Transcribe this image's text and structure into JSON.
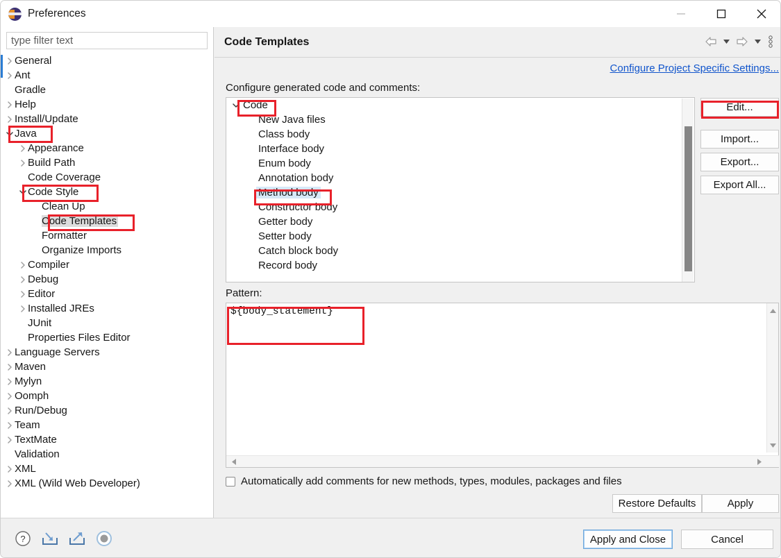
{
  "window": {
    "title": "Preferences",
    "app_icon": "eclipse-icon",
    "controls": {
      "minimize": "minimize-icon",
      "maximize": "maximize-icon",
      "close": "close-icon"
    }
  },
  "sidebar": {
    "filter": {
      "placeholder": "type filter text",
      "value": ""
    },
    "items": [
      {
        "label": "General",
        "indent": 0,
        "twisty": "collapsed",
        "selected": false
      },
      {
        "label": "Ant",
        "indent": 0,
        "twisty": "collapsed",
        "selected": false
      },
      {
        "label": "Gradle",
        "indent": 0,
        "twisty": "none",
        "selected": false
      },
      {
        "label": "Help",
        "indent": 0,
        "twisty": "collapsed",
        "selected": false
      },
      {
        "label": "Install/Update",
        "indent": 0,
        "twisty": "collapsed",
        "selected": false
      },
      {
        "label": "Java",
        "indent": 0,
        "twisty": "expanded",
        "selected": false
      },
      {
        "label": "Appearance",
        "indent": 1,
        "twisty": "collapsed",
        "selected": false
      },
      {
        "label": "Build Path",
        "indent": 1,
        "twisty": "collapsed",
        "selected": false
      },
      {
        "label": "Code Coverage",
        "indent": 1,
        "twisty": "none",
        "selected": false
      },
      {
        "label": "Code Style",
        "indent": 1,
        "twisty": "expanded",
        "selected": false
      },
      {
        "label": "Clean Up",
        "indent": 2,
        "twisty": "none",
        "selected": false
      },
      {
        "label": "Code Templates",
        "indent": 2,
        "twisty": "none",
        "selected": true
      },
      {
        "label": "Formatter",
        "indent": 2,
        "twisty": "none",
        "selected": false
      },
      {
        "label": "Organize Imports",
        "indent": 2,
        "twisty": "none",
        "selected": false
      },
      {
        "label": "Compiler",
        "indent": 1,
        "twisty": "collapsed",
        "selected": false
      },
      {
        "label": "Debug",
        "indent": 1,
        "twisty": "collapsed",
        "selected": false
      },
      {
        "label": "Editor",
        "indent": 1,
        "twisty": "collapsed",
        "selected": false
      },
      {
        "label": "Installed JREs",
        "indent": 1,
        "twisty": "collapsed",
        "selected": false
      },
      {
        "label": "JUnit",
        "indent": 1,
        "twisty": "none",
        "selected": false
      },
      {
        "label": "Properties Files Editor",
        "indent": 1,
        "twisty": "none",
        "selected": false
      },
      {
        "label": "Language Servers",
        "indent": 0,
        "twisty": "collapsed",
        "selected": false
      },
      {
        "label": "Maven",
        "indent": 0,
        "twisty": "collapsed",
        "selected": false
      },
      {
        "label": "Mylyn",
        "indent": 0,
        "twisty": "collapsed",
        "selected": false
      },
      {
        "label": "Oomph",
        "indent": 0,
        "twisty": "collapsed",
        "selected": false
      },
      {
        "label": "Run/Debug",
        "indent": 0,
        "twisty": "collapsed",
        "selected": false
      },
      {
        "label": "Team",
        "indent": 0,
        "twisty": "collapsed",
        "selected": false
      },
      {
        "label": "TextMate",
        "indent": 0,
        "twisty": "collapsed",
        "selected": false
      },
      {
        "label": "Validation",
        "indent": 0,
        "twisty": "none",
        "selected": false
      },
      {
        "label": "XML",
        "indent": 0,
        "twisty": "collapsed",
        "selected": false
      },
      {
        "label": "XML (Wild Web Developer)",
        "indent": 0,
        "twisty": "collapsed",
        "selected": false
      }
    ]
  },
  "panel": {
    "title": "Code Templates",
    "nav": {
      "back": "back-arrow-icon",
      "back_menu": "chevron-down-icon",
      "forward": "forward-arrow-icon",
      "forward_menu": "chevron-down-icon",
      "overflow": "vertical-dots-icon"
    },
    "project_settings_link": "Configure Project Specific Settings...",
    "configure_label": "Configure generated code and comments:",
    "code_tree": [
      {
        "label": "Code",
        "child": false,
        "twisty": "expanded",
        "selected": false
      },
      {
        "label": "New Java files",
        "child": true,
        "twisty": "none",
        "selected": false
      },
      {
        "label": "Class body",
        "child": true,
        "twisty": "none",
        "selected": false
      },
      {
        "label": "Interface body",
        "child": true,
        "twisty": "none",
        "selected": false
      },
      {
        "label": "Enum body",
        "child": true,
        "twisty": "none",
        "selected": false
      },
      {
        "label": "Annotation body",
        "child": true,
        "twisty": "none",
        "selected": false
      },
      {
        "label": "Method body",
        "child": true,
        "twisty": "none",
        "selected": true
      },
      {
        "label": "Constructor body",
        "child": true,
        "twisty": "none",
        "selected": false
      },
      {
        "label": "Getter body",
        "child": true,
        "twisty": "none",
        "selected": false
      },
      {
        "label": "Setter body",
        "child": true,
        "twisty": "none",
        "selected": false
      },
      {
        "label": "Catch block body",
        "child": true,
        "twisty": "none",
        "selected": false
      },
      {
        "label": "Record body",
        "child": true,
        "twisty": "none",
        "selected": false
      }
    ],
    "buttons": {
      "edit": "Edit...",
      "import": "Import...",
      "export": "Export...",
      "export_all": "Export All..."
    },
    "pattern_label": "Pattern:",
    "pattern_value": "${body_statement}",
    "auto_comments_label": "Automatically add comments for new methods, types, modules, packages and files",
    "auto_comments_checked": false,
    "restore_defaults": "Restore Defaults",
    "apply": "Apply"
  },
  "footer": {
    "icons": [
      "help-icon",
      "import-preferences-icon",
      "export-preferences-icon",
      "record-icon"
    ],
    "apply_and_close": "Apply and Close",
    "cancel": "Cancel"
  },
  "colors": {
    "accent": "#2b7cd3",
    "link": "#1155cc",
    "annotation": "#e8212a",
    "selection": "#d6e8f7",
    "tree_selection": "#dcdcdc",
    "panel_bg": "#f0f0f0"
  }
}
